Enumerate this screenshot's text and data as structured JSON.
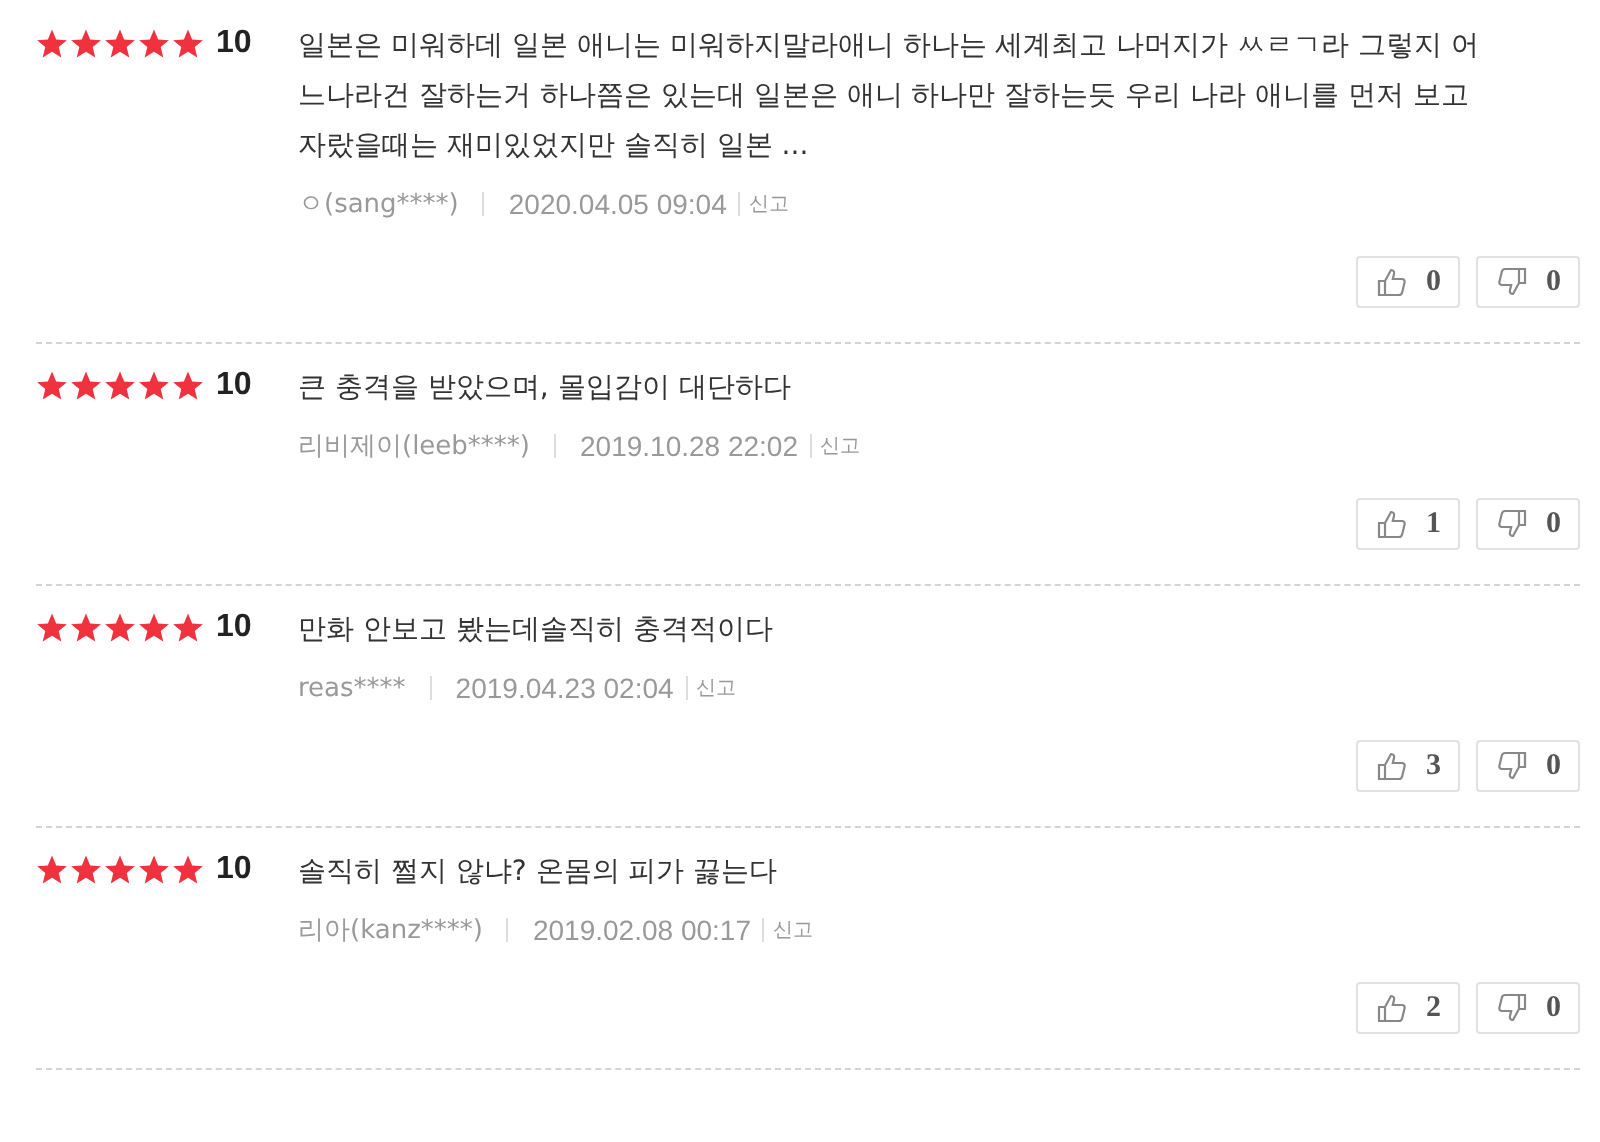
{
  "reviews": [
    {
      "stars": 5,
      "score": "10",
      "text": "일본은 미워하데 일본 애니는 미워하지말라애니 하나는 세계최고 나머지가 ㅆㄹㄱ라 그렇지 어느나라건 잘하는거 하나쯤은 있는대 일본은 애니 하나만 잘하는듯 우리 나라 애니를 먼저 보고 자랐을때는 재미있었지만 솔직히 일본 ...",
      "author": "ㅇ(sang****)",
      "date": "2020.04.05 09:04",
      "report": "신고",
      "likes": "0",
      "dislikes": "0"
    },
    {
      "stars": 5,
      "score": "10",
      "text": "큰 충격을 받았으며, 몰입감이 대단하다",
      "author": "리비제이(leeb****)",
      "date": "2019.10.28 22:02",
      "report": "신고",
      "likes": "1",
      "dislikes": "0"
    },
    {
      "stars": 5,
      "score": "10",
      "text": "만화 안보고 봤는데솔직히 충격적이다",
      "author": "reas****",
      "date": "2019.04.23 02:04",
      "report": "신고",
      "likes": "3",
      "dislikes": "0"
    },
    {
      "stars": 5,
      "score": "10",
      "text": "솔직히 쩔지 않냐? 온몸의 피가 끓는다",
      "author": "리아(kanz****)",
      "date": "2019.02.08 00:17",
      "report": "신고",
      "likes": "2",
      "dislikes": "0"
    }
  ]
}
